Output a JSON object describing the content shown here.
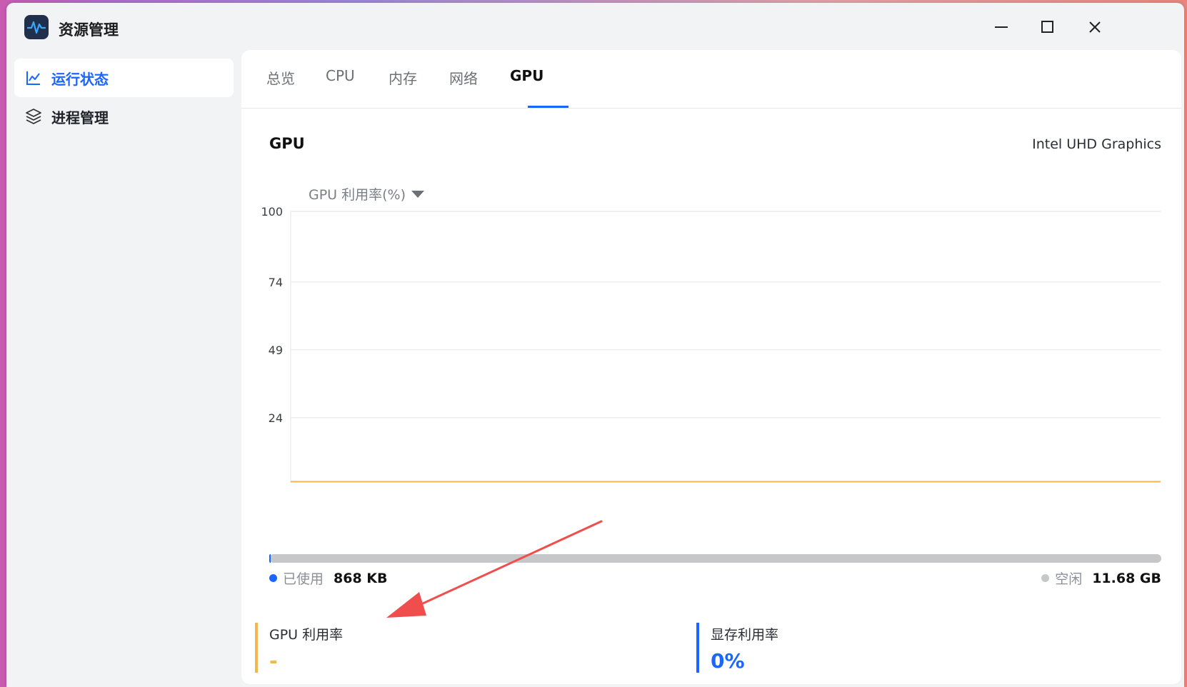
{
  "app": {
    "title": "资源管理"
  },
  "window_controls": {
    "minimize": "minimize-icon",
    "maximize": "maximize-icon",
    "close": "close-icon"
  },
  "sidebar": {
    "items": [
      {
        "label": "运行状态",
        "icon": "line-chart-icon",
        "active": true
      },
      {
        "label": "进程管理",
        "icon": "layers-icon",
        "active": false
      }
    ]
  },
  "tabs": [
    {
      "label": "总览"
    },
    {
      "label": "CPU"
    },
    {
      "label": "内存"
    },
    {
      "label": "网络"
    },
    {
      "label": "GPU",
      "active": true
    }
  ],
  "content": {
    "title": "GPU",
    "device_name": "Intel UHD Graphics",
    "metric_select": "GPU 利用率(%)"
  },
  "chart_data": {
    "type": "line",
    "ylim": [
      0,
      100
    ],
    "yticks": [
      "100",
      "74",
      "49",
      "24"
    ],
    "grid": true,
    "series": [
      {
        "values": [
          0,
          0,
          0,
          0,
          0,
          0,
          0,
          0,
          0,
          0,
          0,
          0,
          0,
          0,
          0,
          0,
          0,
          0,
          0,
          0
        ],
        "color": "#f5b54a"
      }
    ]
  },
  "memory": {
    "used_label": "已使用",
    "used_value": "868 KB",
    "free_label": "空闲",
    "free_value": "11.68 GB",
    "used_fraction": 0.0001,
    "used_color": "#1a66ff",
    "free_color": "#c6c7c9"
  },
  "stats": [
    {
      "label": "GPU 利用率",
      "value": "-",
      "color": "#f5b54a"
    },
    {
      "label": "显存利用率",
      "value": "0%",
      "color": "#1a66ff"
    }
  ],
  "colors": {
    "accent": "#1a66ff",
    "annotation_arrow": "#f04d4d"
  }
}
